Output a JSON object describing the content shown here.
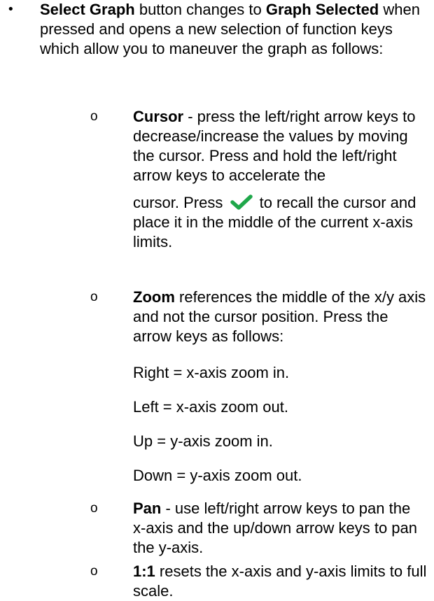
{
  "intro": {
    "bullet": "•",
    "term1": "Select Graph",
    "text1": " button changes to ",
    "term2": "Graph Selected",
    "text2": " when pressed and opens a new selection of function keys which allow you to maneuver the graph as follows:"
  },
  "sub_marker": "o",
  "cursor": {
    "term": "Cursor",
    "text": " - press the left/right arrow keys to decrease/increase the values by moving the cursor. Press and hold the left/right arrow keys to accelerate the",
    "text_before_icon": "cursor. Press ",
    "icon": "checkmark-icon",
    "icon_color": "#1fa74a",
    "text_after_icon": " to recall the cursor and place it in the middle of the current x-axis limits."
  },
  "zoom": {
    "term": "Zoom",
    "text": " references the middle of the x/y axis and not the cursor position. Press the arrow keys as follows:",
    "lines": [
      "Right = x-axis zoom in.",
      "Left = x-axis zoom out.",
      "Up = y-axis zoom in.",
      "Down = y-axis zoom out."
    ]
  },
  "pan": {
    "term": "Pan",
    "text": " - use left/right arrow keys to pan the x-axis and the up/down arrow keys to pan the y-axis."
  },
  "reset": {
    "term": "1:1",
    "text": " resets the x-axis and y-axis limits to full scale."
  }
}
